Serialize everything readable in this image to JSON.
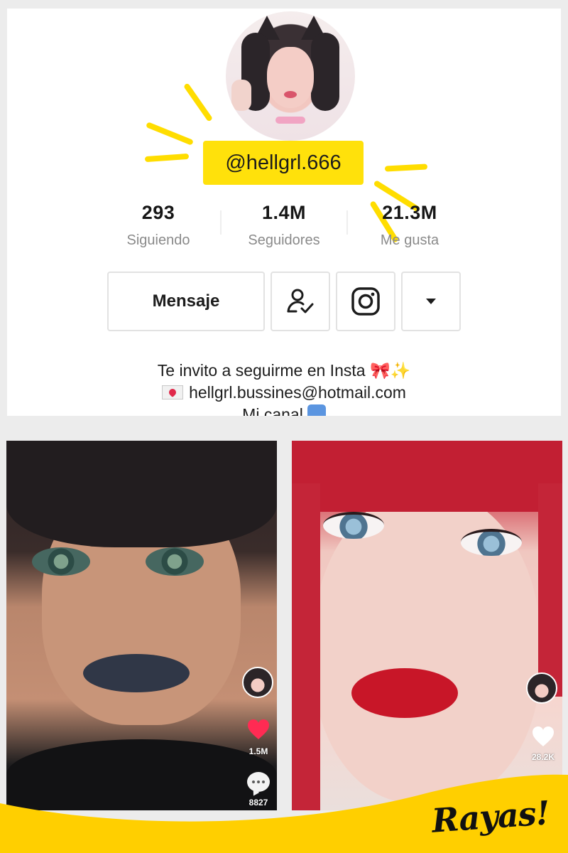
{
  "profile": {
    "handle": "@hellgrl.666",
    "stats": [
      {
        "value": "293",
        "label": "Siguiendo"
      },
      {
        "value": "1.4M",
        "label": "Seguidores"
      },
      {
        "value": "21.3M",
        "label": "Me gusta"
      }
    ],
    "buttons": {
      "message_label": "Mensaje",
      "follow_icon": "user-check-icon",
      "instagram_icon": "instagram-icon",
      "more_icon": "dropdown-caret-icon"
    },
    "bio": {
      "line1": "Te invito a seguirme en Insta 🎀✨",
      "line2": "hellgrl.bussines@hotmail.com",
      "line3": "Mi canal"
    }
  },
  "videos": [
    {
      "likes": "1.5M",
      "comments": "8827",
      "liked": true
    },
    {
      "likes": "28.2K",
      "liked": false
    }
  ],
  "branding": {
    "logo": "Rayas!",
    "accent": "#ffdd00",
    "band_color": "#ffcf00",
    "like_color": "#ff2b53"
  }
}
